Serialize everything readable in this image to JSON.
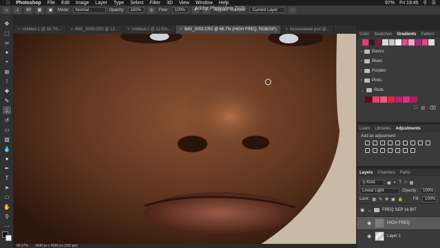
{
  "menubar": {
    "app": "Photoshop",
    "items": [
      "File",
      "Edit",
      "Image",
      "Layer",
      "Type",
      "Select",
      "Filter",
      "3D",
      "View",
      "Window",
      "Help"
    ],
    "battery": "97%",
    "clock": "Fri 19:45"
  },
  "window_title": "Adobe Photoshop 2020",
  "options": {
    "brush_size": "40",
    "mode_label": "Mode:",
    "mode_value": "Normal",
    "opacity_label": "Opacity:",
    "opacity_value": "100%",
    "flow_label": "Flow:",
    "flow_value": "100%",
    "aligned_label": "Aligned",
    "sample_label": "Sample:",
    "sample_value": "Current Layer"
  },
  "tabs": [
    {
      "label": "Untitled-1 @ 16.7%..."
    },
    {
      "label": "IMG_2003.CR2 @ 12..."
    },
    {
      "label": "Untitled-2 @ 12.5%..."
    },
    {
      "label": "IMG_2002.CR2 @ 66.7% (HIGH FREQ, RGB/16*)"
    },
    {
      "label": "fanteeeeeee.psd @..."
    }
  ],
  "status": {
    "zoom": "66.67%",
    "doc": "3648 px x 4560 px (300 ppi)"
  },
  "gradients_panel": {
    "tabs": [
      "Color",
      "Swatches",
      "Gradients",
      "Pattern"
    ],
    "active": "Gradients",
    "folders": [
      "Basics",
      "Blues",
      "Purples",
      "Pinks",
      "Reds"
    ],
    "top_colors": [
      "#e83a7a",
      "#222222",
      "#7a1c3a",
      "#d8d8d8",
      "#c8c8c8",
      "#f0f0f0",
      "#e84a8a",
      "#f6a6c6",
      "#a32a7a",
      "#e7457d",
      "#f4d6e0"
    ],
    "red_colors": [
      "#5a0a18",
      "#e8446a",
      "#f25a7a",
      "#d9284a",
      "#c02070",
      "#e0307f",
      "#b8196b"
    ]
  },
  "adjustments_panel": {
    "tabs": [
      "Learn",
      "Libraries",
      "Adjustments"
    ],
    "active": "Adjustments",
    "hint": "Add an adjustment"
  },
  "layers_panel": {
    "tabs": [
      "Layers",
      "Channels",
      "Paths"
    ],
    "active": "Layers",
    "filter": "Kind",
    "blend_mode": "Linear Light",
    "opacity_label": "Opacity:",
    "opacity_value": "100%",
    "lock_label": "Lock:",
    "fill_label": "Fill:",
    "fill_value": "100%",
    "layers": [
      {
        "name": "FREQ SEP 16 BIT",
        "type": "group"
      },
      {
        "name": "HIGH FREQ",
        "type": "layer"
      },
      {
        "name": "Layer 1",
        "type": "layer"
      }
    ]
  }
}
